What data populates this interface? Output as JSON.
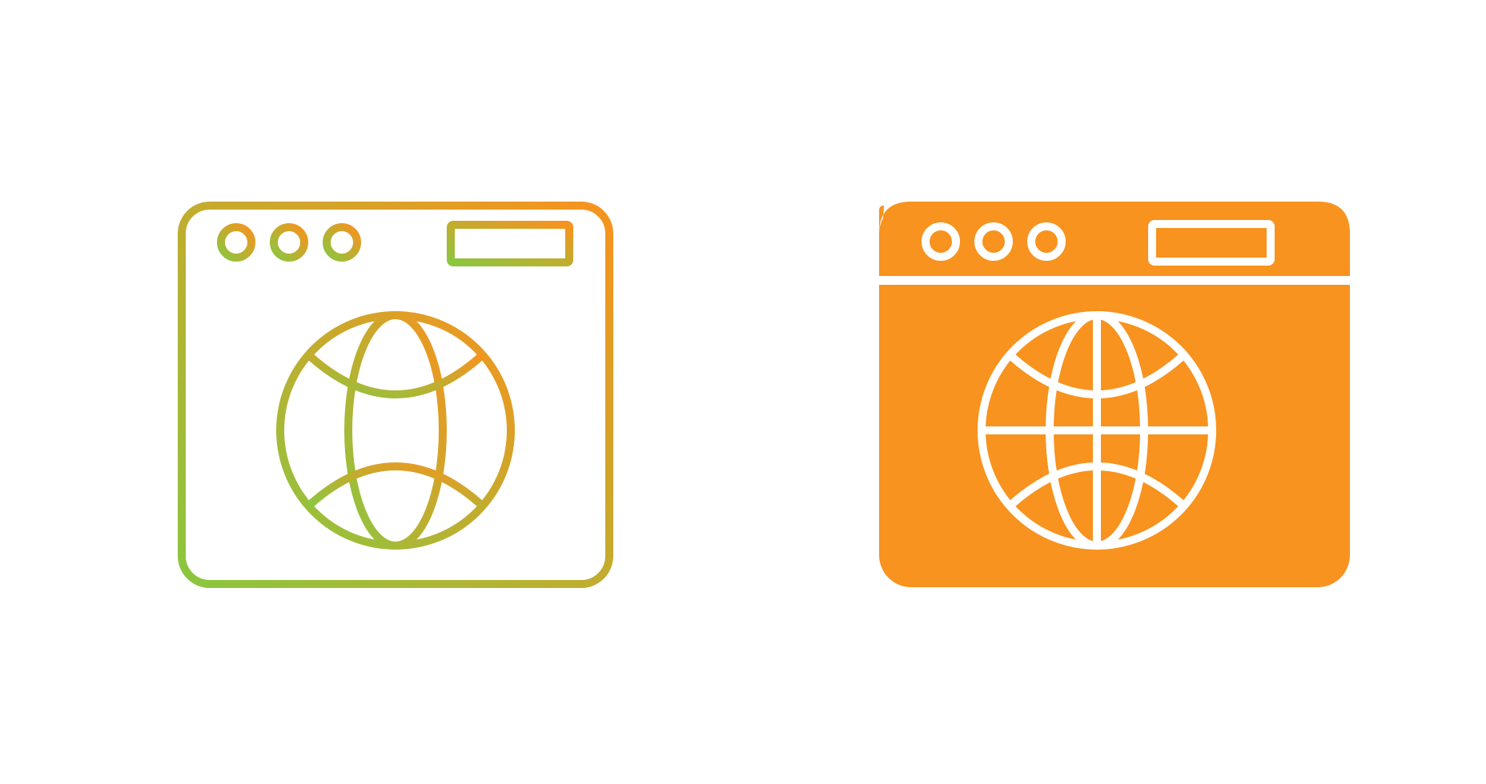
{
  "icons": [
    {
      "name": "web-browser-globe-line-icon",
      "style": "gradient-outline",
      "colors": {
        "gradient_start": "#8cc63f",
        "gradient_end": "#f7931e"
      }
    },
    {
      "name": "web-browser-globe-glyph-icon",
      "style": "filled",
      "colors": {
        "fill": "#f7931e",
        "detail": "#ffffff"
      }
    }
  ]
}
